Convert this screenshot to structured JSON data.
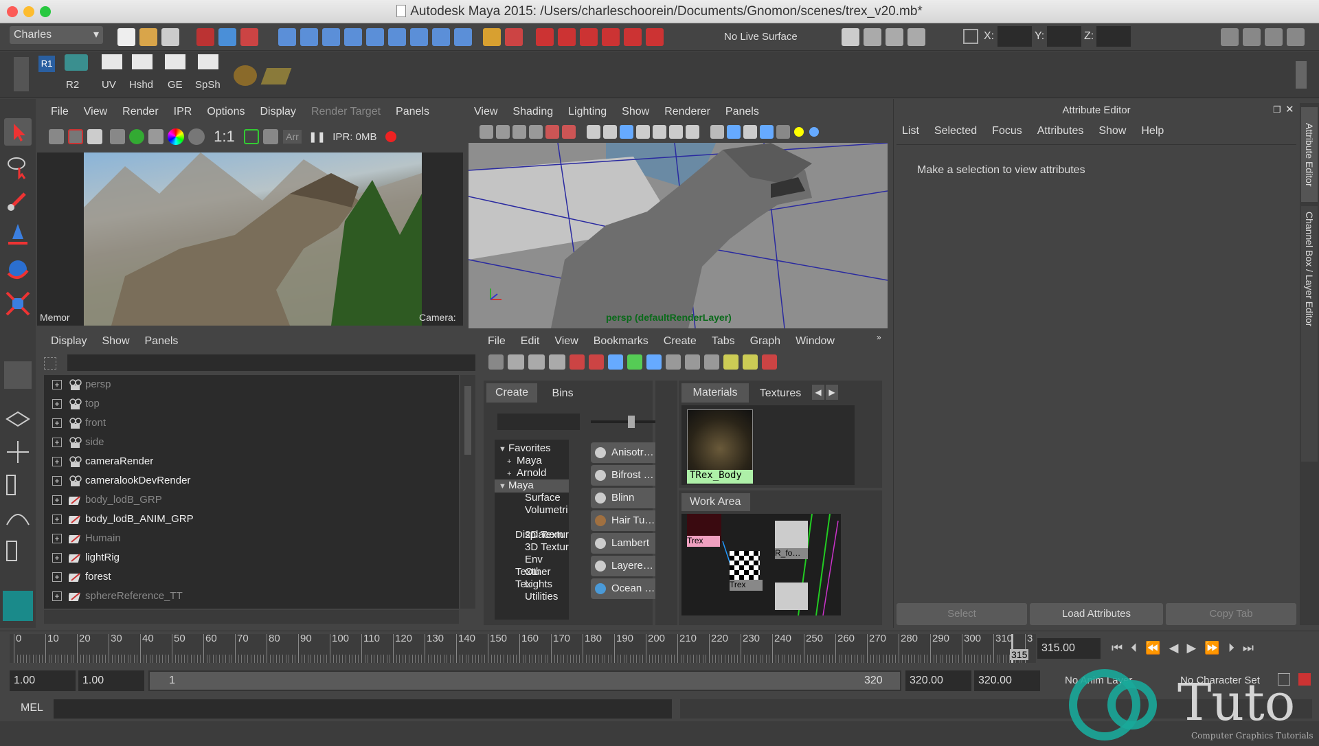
{
  "window": {
    "title": "Autodesk Maya 2015: /Users/charleschoorein/Documents/Gnomon/scenes/trex_v20.mb*"
  },
  "statusline": {
    "menu_set": "Charles",
    "live_surface": "No Live Surface",
    "x_label": "X:",
    "y_label": "Y:",
    "z_label": "Z:"
  },
  "shelf": {
    "items": [
      "R2",
      "UV",
      "Hshd",
      "GE",
      "SpSh"
    ]
  },
  "render_view": {
    "menus": [
      "File",
      "View",
      "Render",
      "IPR",
      "Options",
      "Display",
      "Render Target",
      "Panels"
    ],
    "ratio": "1:1",
    "ipr_label": "Arr",
    "ipr_memory": "IPR: 0MB",
    "memory_label": "Memor",
    "camera_label": "Camera:"
  },
  "viewport": {
    "menus": [
      "View",
      "Shading",
      "Lighting",
      "Show",
      "Renderer",
      "Panels"
    ],
    "camera_label": "persp (defaultRenderLayer)"
  },
  "attribute_editor": {
    "title": "Attribute Editor",
    "menus": [
      "List",
      "Selected",
      "Focus",
      "Attributes",
      "Show",
      "Help"
    ],
    "message": "Make a selection to view attributes",
    "buttons": {
      "select": "Select",
      "load": "Load Attributes",
      "copy": "Copy Tab"
    },
    "side_tabs": {
      "attr": "Attribute Editor",
      "channel": "Channel Box / Layer Editor"
    }
  },
  "outliner": {
    "menus": [
      "Display",
      "Show",
      "Panels"
    ],
    "items": [
      {
        "label": "persp",
        "dim": true,
        "type": "camera"
      },
      {
        "label": "top",
        "dim": true,
        "type": "camera"
      },
      {
        "label": "front",
        "dim": true,
        "type": "camera"
      },
      {
        "label": "side",
        "dim": true,
        "type": "camera"
      },
      {
        "label": "cameraRender",
        "dim": false,
        "type": "camera"
      },
      {
        "label": "cameralookDevRender",
        "dim": false,
        "type": "camera"
      },
      {
        "label": "body_lodB_GRP",
        "dim": true,
        "type": "group"
      },
      {
        "label": "body_lodB_ANIM_GRP",
        "dim": false,
        "type": "group"
      },
      {
        "label": "Humain",
        "dim": true,
        "type": "group"
      },
      {
        "label": "lightRig",
        "dim": false,
        "type": "group"
      },
      {
        "label": "forest",
        "dim": false,
        "type": "group"
      },
      {
        "label": "sphereReference_TT",
        "dim": true,
        "type": "group"
      }
    ]
  },
  "hypershade": {
    "menus": [
      "File",
      "Edit",
      "View",
      "Bookmarks",
      "Create",
      "Tabs",
      "Graph",
      "Window"
    ],
    "tabs": {
      "create": "Create",
      "bins": "Bins",
      "materials": "Materials",
      "textures": "Textures",
      "work_area": "Work Area"
    },
    "tree": [
      {
        "label": "Favorites",
        "prefix": "▼",
        "indent": 0,
        "sel": false
      },
      {
        "label": "Maya",
        "prefix": "+",
        "indent": 1,
        "sel": false
      },
      {
        "label": "Arnold",
        "prefix": "+",
        "indent": 1,
        "sel": false
      },
      {
        "label": "Maya",
        "prefix": "▼",
        "indent": 0,
        "sel": true
      },
      {
        "label": "Surface",
        "prefix": "",
        "indent": 2,
        "sel": false
      },
      {
        "label": "Volumetri",
        "prefix": "",
        "indent": 2,
        "sel": false
      },
      {
        "label": "Displacem",
        "prefix": "",
        "indent": 2,
        "sel": false
      },
      {
        "label": "2D Textur",
        "prefix": "",
        "indent": 2,
        "sel": false
      },
      {
        "label": "3D Textur",
        "prefix": "",
        "indent": 2,
        "sel": false
      },
      {
        "label": "Env Textu",
        "prefix": "",
        "indent": 2,
        "sel": false
      },
      {
        "label": "Other Tex",
        "prefix": "",
        "indent": 2,
        "sel": false
      },
      {
        "label": "Lights",
        "prefix": "",
        "indent": 2,
        "sel": false
      },
      {
        "label": "Utilities",
        "prefix": "",
        "indent": 2,
        "sel": false
      }
    ],
    "nodes": [
      "Anisotr…",
      "Bifrost …",
      "Blinn",
      "Hair Tu…",
      "Lambert",
      "Layere…",
      "Ocean …"
    ],
    "material": "TRex_Body",
    "work_nodes": [
      "Trex",
      "R_fo…",
      "Trex"
    ]
  },
  "timeline": {
    "ticks": [
      "0",
      "10",
      "20",
      "30",
      "40",
      "50",
      "60",
      "70",
      "80",
      "90",
      "100",
      "110",
      "120",
      "130",
      "140",
      "150",
      "160",
      "170",
      "180",
      "190",
      "200",
      "210",
      "220",
      "230",
      "240",
      "250",
      "260",
      "270",
      "280",
      "290",
      "300",
      "310",
      "3"
    ],
    "current_marker": "315",
    "current_frame": "315.00"
  },
  "range": {
    "start": "1.00",
    "anim_start": "1.00",
    "slider_start": "1",
    "slider_end": "320",
    "anim_end": "320.00",
    "end": "320.00",
    "anim_layer": "No Anim Layer",
    "char_set": "No Character Set"
  },
  "command": {
    "label": "MEL"
  },
  "watermark": {
    "text": "Tuto",
    "sub": "Computer Graphics Tutorials"
  }
}
